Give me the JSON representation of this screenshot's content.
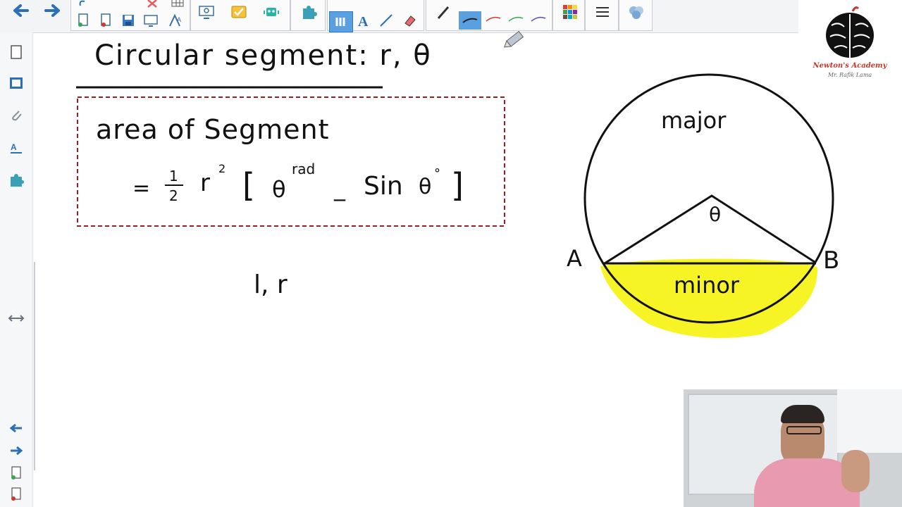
{
  "toolbar": {
    "back_icon": "arrow-left-icon",
    "forward_icon": "arrow-right-icon",
    "groups": [
      "file",
      "insert",
      "screen",
      "tools",
      "pens",
      "colors",
      "properties",
      "gallery"
    ]
  },
  "left_rail": {
    "items": [
      "page-sorter-icon",
      "gallery-icon",
      "attachments-icon",
      "properties-icon",
      "addons-icon"
    ],
    "bottom": [
      "prev-page-icon",
      "next-page-icon",
      "add-page-icon",
      "delete-page-icon"
    ]
  },
  "whiteboard": {
    "title": "Circular segment: r, θ",
    "box_line1": "area of Segment",
    "formula_prefix": "= ",
    "formula_half_num": "1",
    "formula_half_den": "2",
    "formula_r": "r",
    "formula_sq": "2",
    "formula_open": "[",
    "formula_theta": "θ",
    "formula_rad": "rad",
    "formula_minus": "_",
    "formula_sin": "Sin",
    "formula_theta2": "θ",
    "formula_deg": "°",
    "formula_close": "]",
    "note": "l, r",
    "circle_major": "major",
    "circle_minor": "minor",
    "circle_theta": "θ",
    "point_a": "A",
    "point_b": "B"
  },
  "logo": {
    "name": "Newton's Academy",
    "subtitle": "Mr. Rafik Lama"
  },
  "colors": {
    "highlight": "#f6f200",
    "box_border": "#9b1c22",
    "toolbar_blue": "#2e7bc7",
    "accent_red": "#c0392b"
  }
}
